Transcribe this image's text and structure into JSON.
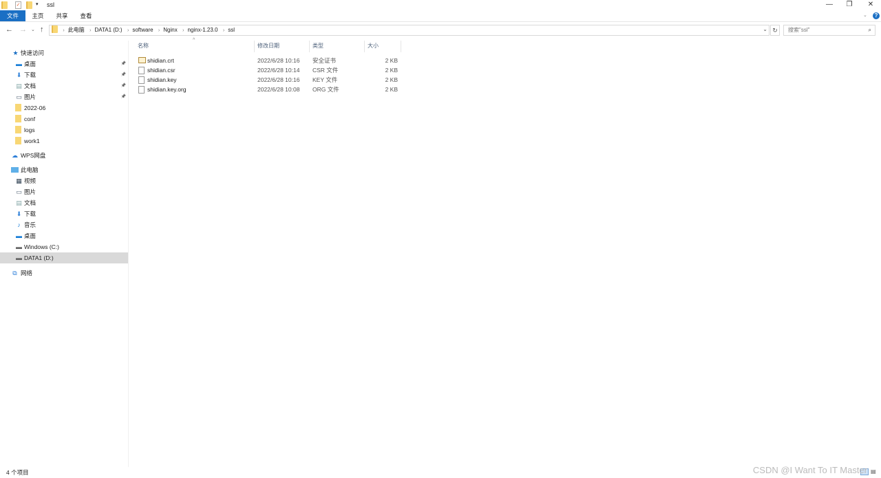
{
  "window": {
    "title": "ssl",
    "minimize": "—",
    "restore": "❐",
    "close": "✕",
    "help": "?"
  },
  "ribbon": {
    "tabs": [
      "文件",
      "主页",
      "共享",
      "查看"
    ]
  },
  "address": {
    "crumbs": [
      "此电脑",
      "DATA1 (D:)",
      "software",
      "Nginx",
      "nginx-1.23.0",
      "ssl"
    ]
  },
  "search": {
    "placeholder": "搜索\"ssl\""
  },
  "sidebar": {
    "quick_access": "快速访问",
    "quick_items": [
      {
        "label": "桌面",
        "icon": "desktop-icon",
        "pinned": true
      },
      {
        "label": "下载",
        "icon": "download-icon",
        "pinned": true
      },
      {
        "label": "文档",
        "icon": "document-icon",
        "pinned": true
      },
      {
        "label": "图片",
        "icon": "picture-icon",
        "pinned": true
      },
      {
        "label": "2022-06",
        "icon": "folder-icon"
      },
      {
        "label": "conf",
        "icon": "folder-icon"
      },
      {
        "label": "logs",
        "icon": "folder-icon"
      },
      {
        "label": "work1",
        "icon": "folder-icon"
      }
    ],
    "wps": "WPS网盘",
    "this_pc": "此电脑",
    "pc_items": [
      {
        "label": "视频",
        "icon": "video-icon"
      },
      {
        "label": "图片",
        "icon": "picture-icon"
      },
      {
        "label": "文档",
        "icon": "document-icon"
      },
      {
        "label": "下载",
        "icon": "download-icon"
      },
      {
        "label": "音乐",
        "icon": "music-icon"
      },
      {
        "label": "桌面",
        "icon": "desktop-icon"
      },
      {
        "label": "Windows (C:)",
        "icon": "drive-icon"
      },
      {
        "label": "DATA1 (D:)",
        "icon": "drive-icon",
        "selected": true
      }
    ],
    "network": "网络"
  },
  "columns": [
    "名称",
    "修改日期",
    "类型",
    "大小"
  ],
  "files": [
    {
      "name": "shidian.crt",
      "date": "2022/6/28 10:16",
      "type": "安全证书",
      "size": "2 KB"
    },
    {
      "name": "shidian.csr",
      "date": "2022/6/28 10:14",
      "type": "CSR 文件",
      "size": "2 KB"
    },
    {
      "name": "shidian.key",
      "date": "2022/6/28 10:16",
      "type": "KEY 文件",
      "size": "2 KB"
    },
    {
      "name": "shidian.key.org",
      "date": "2022/6/28 10:08",
      "type": "ORG 文件",
      "size": "2 KB"
    }
  ],
  "status": {
    "count": "4 个项目"
  },
  "watermark": "CSDN @I Want To IT Master",
  "colors": {
    "accent": "#1a6fc4",
    "selected": "#d9d9d9"
  }
}
